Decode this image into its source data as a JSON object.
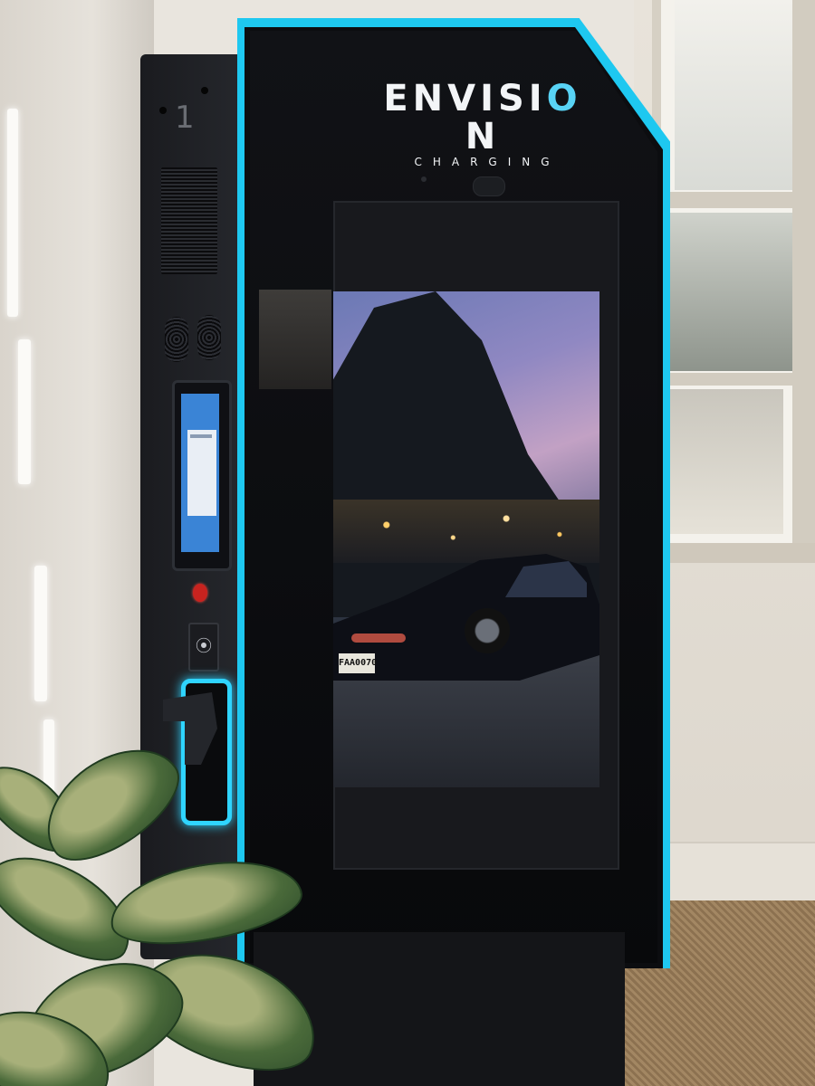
{
  "brand": {
    "name_left": "ENVISI",
    "name_ring": "O",
    "name_right": "N",
    "sub": "CHARGING"
  },
  "side_panel": {
    "unit_number": "1"
  },
  "screen": {
    "plate_text": "FAA0070"
  },
  "colors": {
    "accent_glow": "#1ec8f0",
    "kiosk_body": "#0c0d10",
    "payment_screen": "#3a84d6",
    "estop": "#c8231f"
  },
  "icons": {
    "rfid": "contactless-payment-icon",
    "estop": "emergency-stop-icon"
  }
}
